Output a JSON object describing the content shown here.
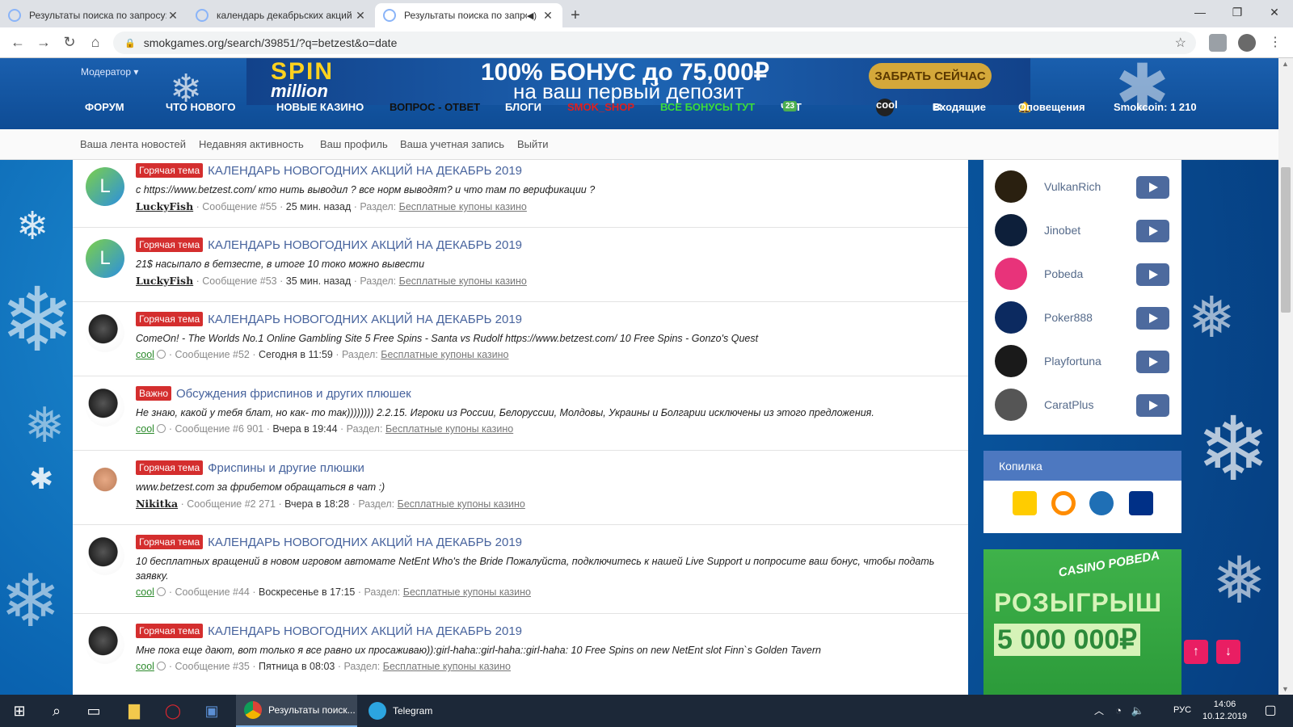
{
  "browser": {
    "tabs": [
      {
        "title": "Результаты поиска по запросу: betzest",
        "active": false
      },
      {
        "title": "календарь декабрьских акций | Casino",
        "active": false
      },
      {
        "title": "Результаты поиска по запросу",
        "active": true
      }
    ],
    "url": "smokgames.org/search/39851/?q=betzest&o=date"
  },
  "header": {
    "moderator": "Модератор ▾",
    "banner": {
      "brand": "SPIN",
      "brand_sub": "million",
      "line1": "100% БОНУС до 75,000₽",
      "line2": "на ваш первый депозит",
      "cta": "ЗАБРАТЬ СЕЙЧАС"
    },
    "menu": {
      "forum": "ФОРУМ",
      "whats_new": "ЧТО НОВОГО",
      "new_casinos": "НОВЫЕ КАЗИНО",
      "qa": "ВОПРОС - ОТВЕТ",
      "blogs": "БЛОГИ",
      "shop": "SMOK_SHOP",
      "bonuses": "ВСЕ БОНУСЫ ТУТ",
      "chat": "ЧАТ",
      "chat_count": "23",
      "user": "cool",
      "inbox": "Входящие",
      "alerts": "Оповещения",
      "coins": "Smokcoin: 1 210"
    },
    "subnav": [
      "Ваша лента новостей",
      "Недавняя активность",
      "Ваш профиль",
      "Ваша учетная запись",
      "Выйти"
    ]
  },
  "results": [
    {
      "badge": "Горячая тема",
      "title": "КАЛЕНДАРЬ НОВОГОДНИХ АКЦИЙ НА ДЕКАБРЬ 2019",
      "snippet": "с https://www.betzest.com/ кто нить выводил ? все норм выводят? и что там по верификации ?",
      "user": "LuckyFish",
      "post": "Сообщение #55",
      "date": "25 мин. назад",
      "section_label": "Раздел:",
      "section": "Бесплатные купоны казино"
    },
    {
      "badge": "Горячая тема",
      "title": "КАЛЕНДАРЬ НОВОГОДНИХ АКЦИЙ НА ДЕКАБРЬ 2019",
      "snippet": "21$ насыпало в бетзесте, в итоге 10 токо можно вывести",
      "user": "LuckyFish",
      "post": "Сообщение #53",
      "date": "35 мин. назад",
      "section_label": "Раздел:",
      "section": "Бесплатные купоны казино"
    },
    {
      "badge": "Горячая тема",
      "title": "КАЛЕНДАРЬ НОВОГОДНИХ АКЦИЙ НА ДЕКАБРЬ 2019",
      "snippet": "ComeOn! - The Worlds No.1 Online Gambling Site 5 Free Spins - Santa vs Rudolf https://www.betzest.com/ 10 Free Spins - Gonzo's Quest",
      "user": "cool",
      "post": "Сообщение #52",
      "date": "Сегодня в 11:59",
      "section_label": "Раздел:",
      "section": "Бесплатные купоны казино"
    },
    {
      "badge": "Важно",
      "title": "Обсуждения фриспинов и других плюшек",
      "snippet": "Не знаю, какой у тебя блат, но как- то так)))))))) 2.2.15. Игроки из России, Белоруссии, Молдовы, Украины и Болгарии исключены из этого предложения.",
      "user": "cool",
      "post": "Сообщение #6 901",
      "date": "Вчера в 19:44",
      "section_label": "Раздел:",
      "section": "Бесплатные купоны казино"
    },
    {
      "badge": "Горячая тема",
      "title": "Фриспины и другие плюшки",
      "snippet": "www.betzest.com за фрибетом обращаться в чат :)",
      "user": "Nikitka",
      "post": "Сообщение #2 271",
      "date": "Вчера в 18:28",
      "section_label": "Раздел:",
      "section": "Бесплатные купоны казино"
    },
    {
      "badge": "Горячая тема",
      "title": "КАЛЕНДАРЬ НОВОГОДНИХ АКЦИЙ НА ДЕКАБРЬ 2019",
      "snippet": "10 бесплатных вращений в новом игровом автомате NetEnt Who's the Bride Пожалуйста, подключитесь к нашей Live Support и попросите ваш бонус, чтобы подать заявку.",
      "user": "cool",
      "post": "Сообщение #44",
      "date": "Воскресенье в 17:15",
      "section_label": "Раздел:",
      "section": "Бесплатные купоны казино"
    },
    {
      "badge": "Горячая тема",
      "title": "КАЛЕНДАРЬ НОВОГОДНИХ АКЦИЙ НА ДЕКАБРЬ 2019",
      "snippet": "Мне пока еще дают, вот только я все равно их просаживаю)):girl-haha::girl-haha::girl-haha: 10 Free Spins on new NetEnt slot Finn`s Golden Tavern",
      "user": "cool",
      "post": "Сообщение #35",
      "date": "Пятница в 08:03",
      "section_label": "Раздел:",
      "section": "Бесплатные купоны казино"
    }
  ],
  "sidebar": {
    "casinos": [
      {
        "name": "VulkanRich",
        "color": "#2a2010"
      },
      {
        "name": "Jinobet",
        "color": "#0d1f3a"
      },
      {
        "name": "Pobeda",
        "color": "#e8337a"
      },
      {
        "name": "Poker888",
        "color": "#0c2a60"
      },
      {
        "name": "Playfortuna",
        "color": "#1a1a1a"
      },
      {
        "name": "CaratPlus",
        "color": "#555555"
      }
    ],
    "kopilka": "Копилка",
    "promo": {
      "brand": "CASINO POBEDA",
      "line1": "РОЗЫГРЫШ",
      "line2": "5 000 000₽"
    }
  },
  "taskbar": {
    "apps": [
      "Результаты поиск...",
      "Telegram"
    ],
    "lang": "РУС",
    "time": "14:06",
    "date": "10.12.2019"
  },
  "colors": {
    "accent": "#47639d",
    "hot_badge": "#d42e2e",
    "play": "#4d6a9e",
    "kopilka_header": "#4d78c0"
  }
}
